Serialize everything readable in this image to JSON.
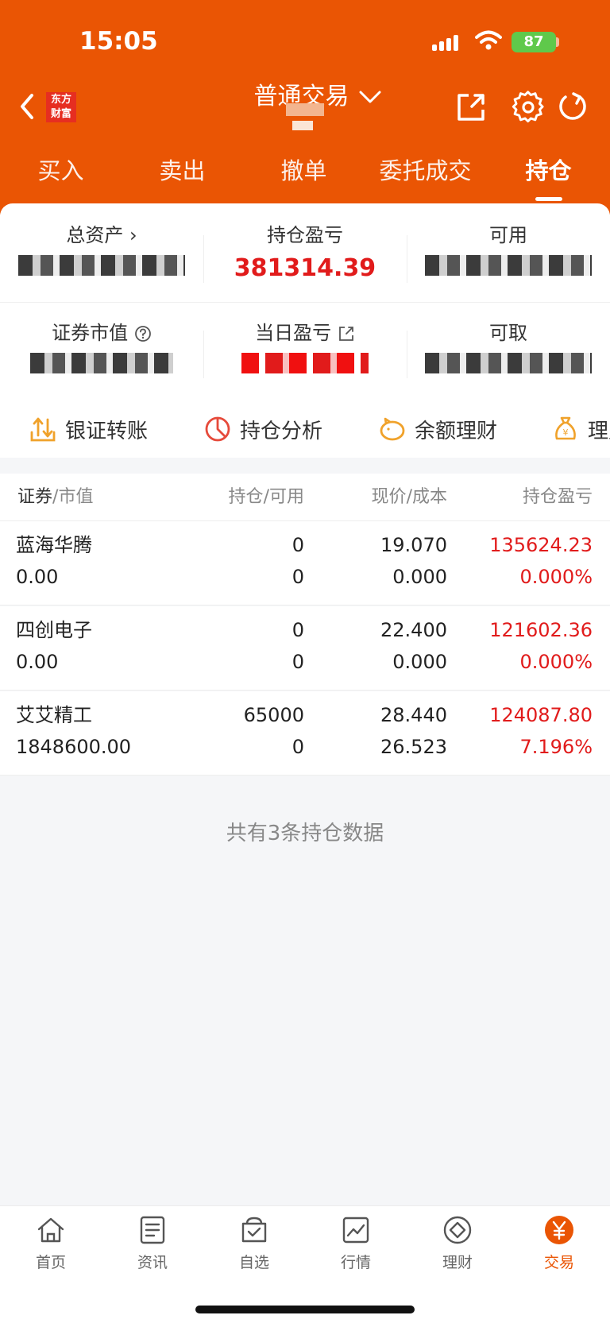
{
  "status_bar": {
    "time": "15:05",
    "battery": "87"
  },
  "header": {
    "brand_logo": "东方财富",
    "title": "普通交易"
  },
  "tabs": [
    {
      "label": "买入"
    },
    {
      "label": "卖出"
    },
    {
      "label": "撤单"
    },
    {
      "label": "委托成交"
    },
    {
      "label": "持仓"
    }
  ],
  "summary": {
    "total_assets_label": "总资产",
    "position_pnl_label": "持仓盈亏",
    "position_pnl_value": "381314.39",
    "available_label": "可用",
    "market_value_label": "证券市值",
    "daily_pnl_label": "当日盈亏",
    "withdrawable_label": "可取"
  },
  "shortcuts": [
    {
      "label": "银证转账",
      "icon": "transfer-icon"
    },
    {
      "label": "持仓分析",
      "icon": "pie-chart-icon"
    },
    {
      "label": "余额理财",
      "icon": "piggy-bank-icon"
    },
    {
      "label": "理财",
      "icon": "money-bag-icon"
    }
  ],
  "table": {
    "headers": {
      "security": "证券",
      "market_value": "市值",
      "holding": "持仓",
      "available": "可用",
      "price": "现价",
      "cost": "成本",
      "pnl": "持仓盈亏"
    },
    "rows": [
      {
        "name": "蓝海华腾",
        "market_value": "0.00",
        "holding": "0",
        "available": "0",
        "price": "19.070",
        "cost": "0.000",
        "pnl": "135624.23",
        "pnl_pct": "0.000%"
      },
      {
        "name": "四创电子",
        "market_value": "0.00",
        "holding": "0",
        "available": "0",
        "price": "22.400",
        "cost": "0.000",
        "pnl": "121602.36",
        "pnl_pct": "0.000%"
      },
      {
        "name": "艾艾精工",
        "market_value": "1848600.00",
        "holding": "65000",
        "available": "0",
        "price": "28.440",
        "cost": "26.523",
        "pnl": "124087.80",
        "pnl_pct": "7.196%"
      }
    ],
    "count_text": "共有3条持仓数据"
  },
  "bottom_nav": [
    {
      "label": "首页",
      "icon": "home-icon"
    },
    {
      "label": "资讯",
      "icon": "news-icon"
    },
    {
      "label": "自选",
      "icon": "watchlist-icon"
    },
    {
      "label": "行情",
      "icon": "market-chart-icon"
    },
    {
      "label": "理财",
      "icon": "wealth-icon"
    },
    {
      "label": "交易",
      "icon": "trade-yuan-icon"
    }
  ],
  "colors": {
    "brand": "#ea5504",
    "gain": "#e11b1b"
  }
}
